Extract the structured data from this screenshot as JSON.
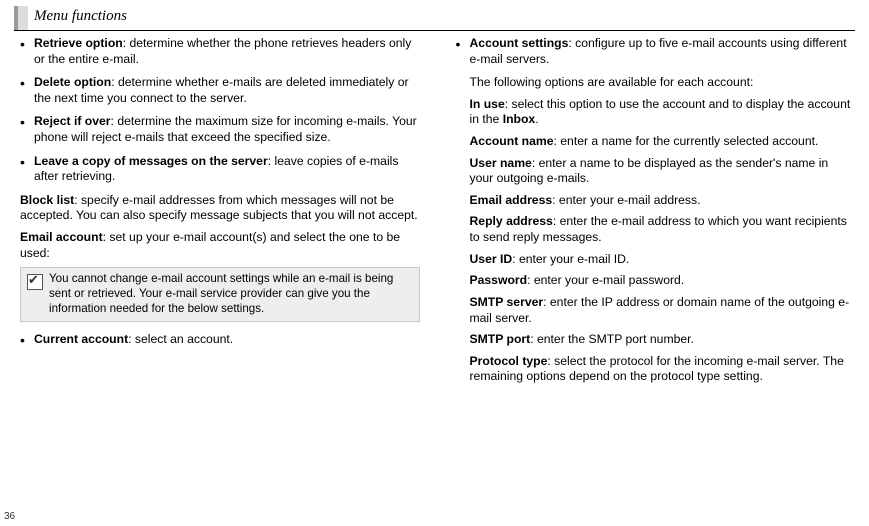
{
  "header": {
    "title": "Menu functions"
  },
  "pageNumber": "36",
  "left": {
    "bullets": [
      {
        "term": "Retrieve option",
        "desc": ": determine whether the phone retrieves headers only or the entire e-mail."
      },
      {
        "term": "Delete option",
        "desc": ": determine whether e-mails are deleted immediately or the next time you connect to the server."
      },
      {
        "term": "Reject if over",
        "desc": ": determine the maximum size for incoming e-mails. Your phone will reject e-mails that exceed the specified size."
      },
      {
        "term": "Leave a copy of messages on the server",
        "desc": ": leave copies of e-mails after retrieving."
      }
    ],
    "blockList": {
      "term": "Block list",
      "desc": ": specify e-mail addresses from which messages will not be accepted. You can also specify message subjects that you will not accept."
    },
    "emailAccount": {
      "term": "Email account",
      "desc": ": set up your e-mail account(s) and select the one to be used:"
    },
    "note": "You cannot change e-mail account settings while an e-mail is being sent or retrieved. Your e-mail service provider can give you the information needed for the below settings.",
    "currentAccount": {
      "term": "Current account",
      "desc": ": select an account."
    }
  },
  "right": {
    "accountSettings": {
      "term": "Account settings",
      "desc": ": configure up to five e-mail accounts using different e-mail servers."
    },
    "availableText": "The following options are available for each account:",
    "opts": [
      {
        "term": "In use",
        "desc1": ": select this option to use the account and to display the account in the ",
        "boldTail": "Inbox",
        "desc2": "."
      },
      {
        "term": "Account name",
        "desc": ": enter a name for the currently selected account."
      },
      {
        "term": "User name",
        "desc": ": enter a name to be displayed as the sender's name in your outgoing e-mails."
      },
      {
        "term": "Email address",
        "desc": ": enter your e-mail address."
      },
      {
        "term": "Reply address",
        "desc": ": enter the e-mail address to which you want recipients to send reply messages."
      },
      {
        "term": "User ID",
        "desc": ": enter your e-mail ID."
      },
      {
        "term": "Password",
        "desc": ": enter your e-mail password."
      },
      {
        "term": "SMTP server",
        "desc": ": enter the IP address or domain name of the outgoing e-mail server."
      },
      {
        "term": "SMTP port",
        "desc": ": enter the SMTP port number."
      },
      {
        "term": "Protocol type",
        "desc": ": select the protocol for the incoming e-mail server. The remaining options depend on the protocol type setting."
      }
    ]
  }
}
